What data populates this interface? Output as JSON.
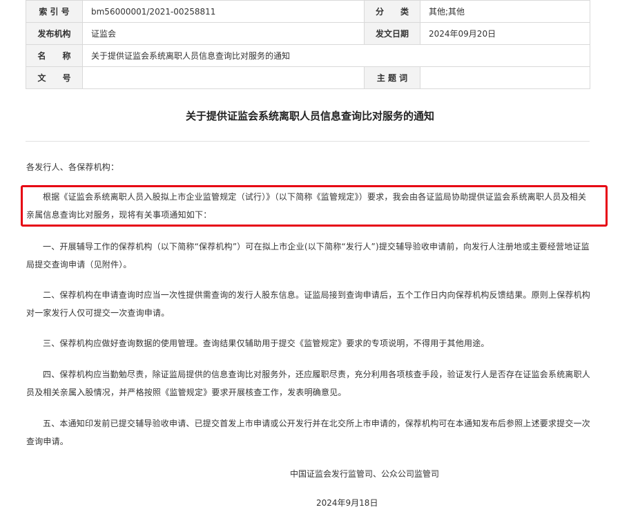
{
  "meta": {
    "index_label": "索 引 号",
    "index_value": "bm56000001/2021-00258811",
    "category_label": "分　　类",
    "category_value": "其他;其他",
    "issuer_label": "发布机构",
    "issuer_value": "证监会",
    "date_label": "发文日期",
    "date_value": "2024年09月20日",
    "name_label": "名　　称",
    "name_value": "关于提供证监会系统离职人员信息查询比对服务的通知",
    "docno_label": "文　　号",
    "docno_value": "",
    "subject_label": "主 题 词",
    "subject_value": ""
  },
  "document": {
    "title": "关于提供证监会系统离职人员信息查询比对服务的通知",
    "salutation": "各发行人、各保荐机构：",
    "paragraphs": [
      "根据《证监会系统离职人员入股拟上市企业监管规定（试行）》（以下简称《监管规定》）要求，我会由各证监局协助提供证监会系统离职人员及相关亲属信息查询比对服务，现将有关事项通知如下：",
      "一、开展辅导工作的保荐机构（以下简称“保荐机构”）可在拟上市企业(以下简称“发行人”)提交辅导验收申请前，向发行人注册地或主要经营地证监局提交查询申请（见附件）。",
      "二、保荐机构在申请查询时应当一次性提供需查询的发行人股东信息。证监局接到查询申请后，五个工作日内向保荐机构反馈结果。原则上保荐机构对一家发行人仅可提交一次查询申请。",
      "三、保荐机构应做好查询数据的使用管理。查询结果仅辅助用于提交《监管规定》要求的专项说明，不得用于其他用途。",
      "四、保荐机构应当勤勉尽责，除证监局提供的信息查询比对服务外，还应履职尽责，充分利用各项核查手段，验证发行人是否存在证监会系统离职人员及相关亲属入股情况，并严格按照《监管规定》要求开展核查工作，发表明确意见。",
      "五、本通知印发前已提交辅导验收申请、已提交首发上市申请或公开发行并在北交所上市申请的，保荐机构可在本通知发布后参照上述要求提交一次查询申请。"
    ],
    "signature": "中国证监会发行监管司、公众公司监管司",
    "sign_date": "2024年9月18日"
  },
  "colors": {
    "highlight_border": "#e60012",
    "label_bg": "#f3f3f3",
    "table_border": "#d9d9d9"
  }
}
